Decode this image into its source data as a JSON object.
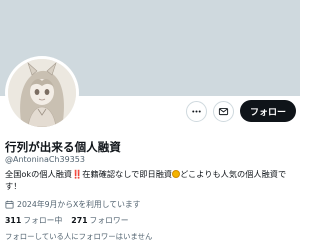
{
  "profile": {
    "display_name": "行列が出来る個人融資",
    "handle": "@AntoninaCh39353",
    "bio": {
      "part1": "全国okの個人融資",
      "exclaim": "‼️",
      "part2": "在籍確認なしで即日融資",
      "part3": "どこよりも人気の個人融資です！"
    },
    "joined": "2024年9月からXを利用しています",
    "following_count": "311",
    "following_label": "フォロー中",
    "followers_count": "271",
    "followers_label": "フォロワー",
    "followers_you_know": "フォローしている人にフォロワーはいません"
  },
  "actions": {
    "more_icon": "more-icon",
    "message_icon": "mail-icon",
    "follow_label": "フォロー"
  },
  "colors": {
    "banner": "#cfd9de",
    "text_primary": "#0f1419",
    "text_secondary": "#536471",
    "follow_button": "#0f1419"
  }
}
